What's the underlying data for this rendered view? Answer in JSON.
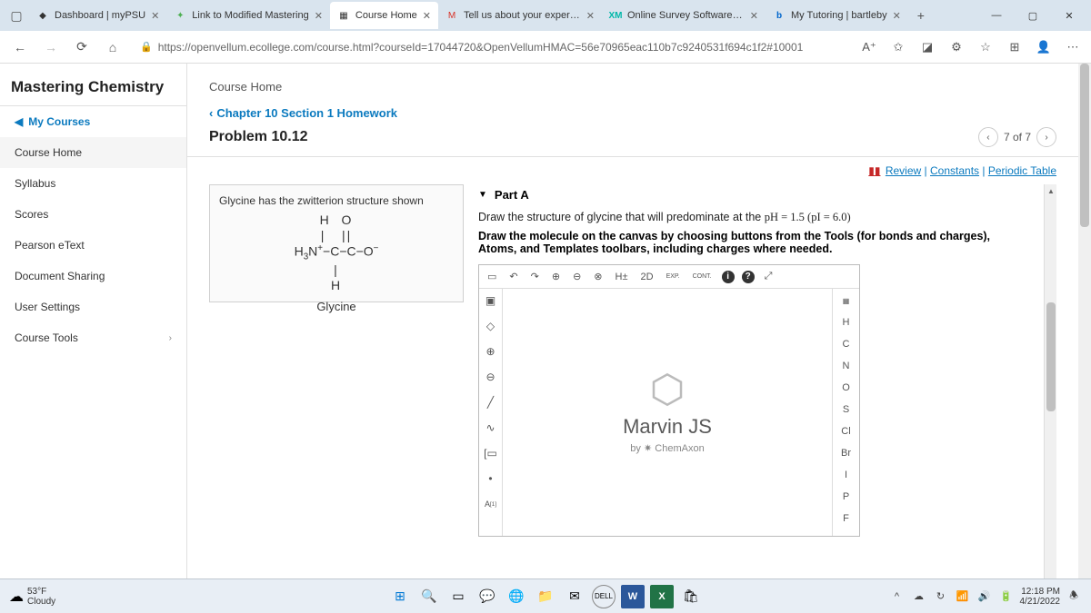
{
  "browser": {
    "tabs": [
      {
        "title": "Dashboard | myPSU"
      },
      {
        "title": "Link to Modified Mastering"
      },
      {
        "title": "Course Home"
      },
      {
        "title": "Tell us about your experien"
      },
      {
        "title": "Online Survey Software | Q"
      },
      {
        "title": "My Tutoring | bartleby"
      }
    ],
    "url": "https://openvellum.ecollege.com/course.html?courseId=17044720&OpenVellumHMAC=56e70965eac110b7c9240531f694c1f2#10001"
  },
  "app": {
    "brand": "Mastering Chemistry",
    "topCrumb": "Course Home",
    "sidebar": {
      "myCourses": "My Courses",
      "items": [
        "Course Home",
        "Syllabus",
        "Scores",
        "Pearson eText",
        "Document Sharing",
        "User Settings",
        "Course Tools"
      ]
    }
  },
  "assignment": {
    "breadcrumb": "Chapter 10 Section 1 Homework",
    "problem": "Problem 10.12",
    "pager": "7 of 7",
    "links": {
      "review": "Review",
      "constants": "Constants",
      "periodic": "Periodic Table"
    }
  },
  "glycine": {
    "intro": "Glycine has the zwitterion structure shown",
    "label": "Glycine"
  },
  "part": {
    "header": "Part A",
    "instr1_pre": "Draw the structure of glycine that will predominate at the ",
    "instr1_math": "pH = 1.5 (pI = 6.0)",
    "instr2": "Draw the molecule on the canvas by choosing buttons from the Tools (for bonds and charges), Atoms, and Templates toolbars, including charges where needed."
  },
  "editor": {
    "marvin": "Marvin JS",
    "by": "by ",
    "chemaxon": "ChemAxon",
    "atoms": [
      "H",
      "C",
      "N",
      "O",
      "S",
      "Cl",
      "Br",
      "I",
      "P",
      "F"
    ],
    "topTools": {
      "h": "H",
      "d2": "2D",
      "exp": "EXP.",
      "cont": "CONT."
    }
  },
  "taskbar": {
    "temp": "53°F",
    "cond": "Cloudy",
    "time": "12:18 PM",
    "date": "4/21/2022"
  }
}
